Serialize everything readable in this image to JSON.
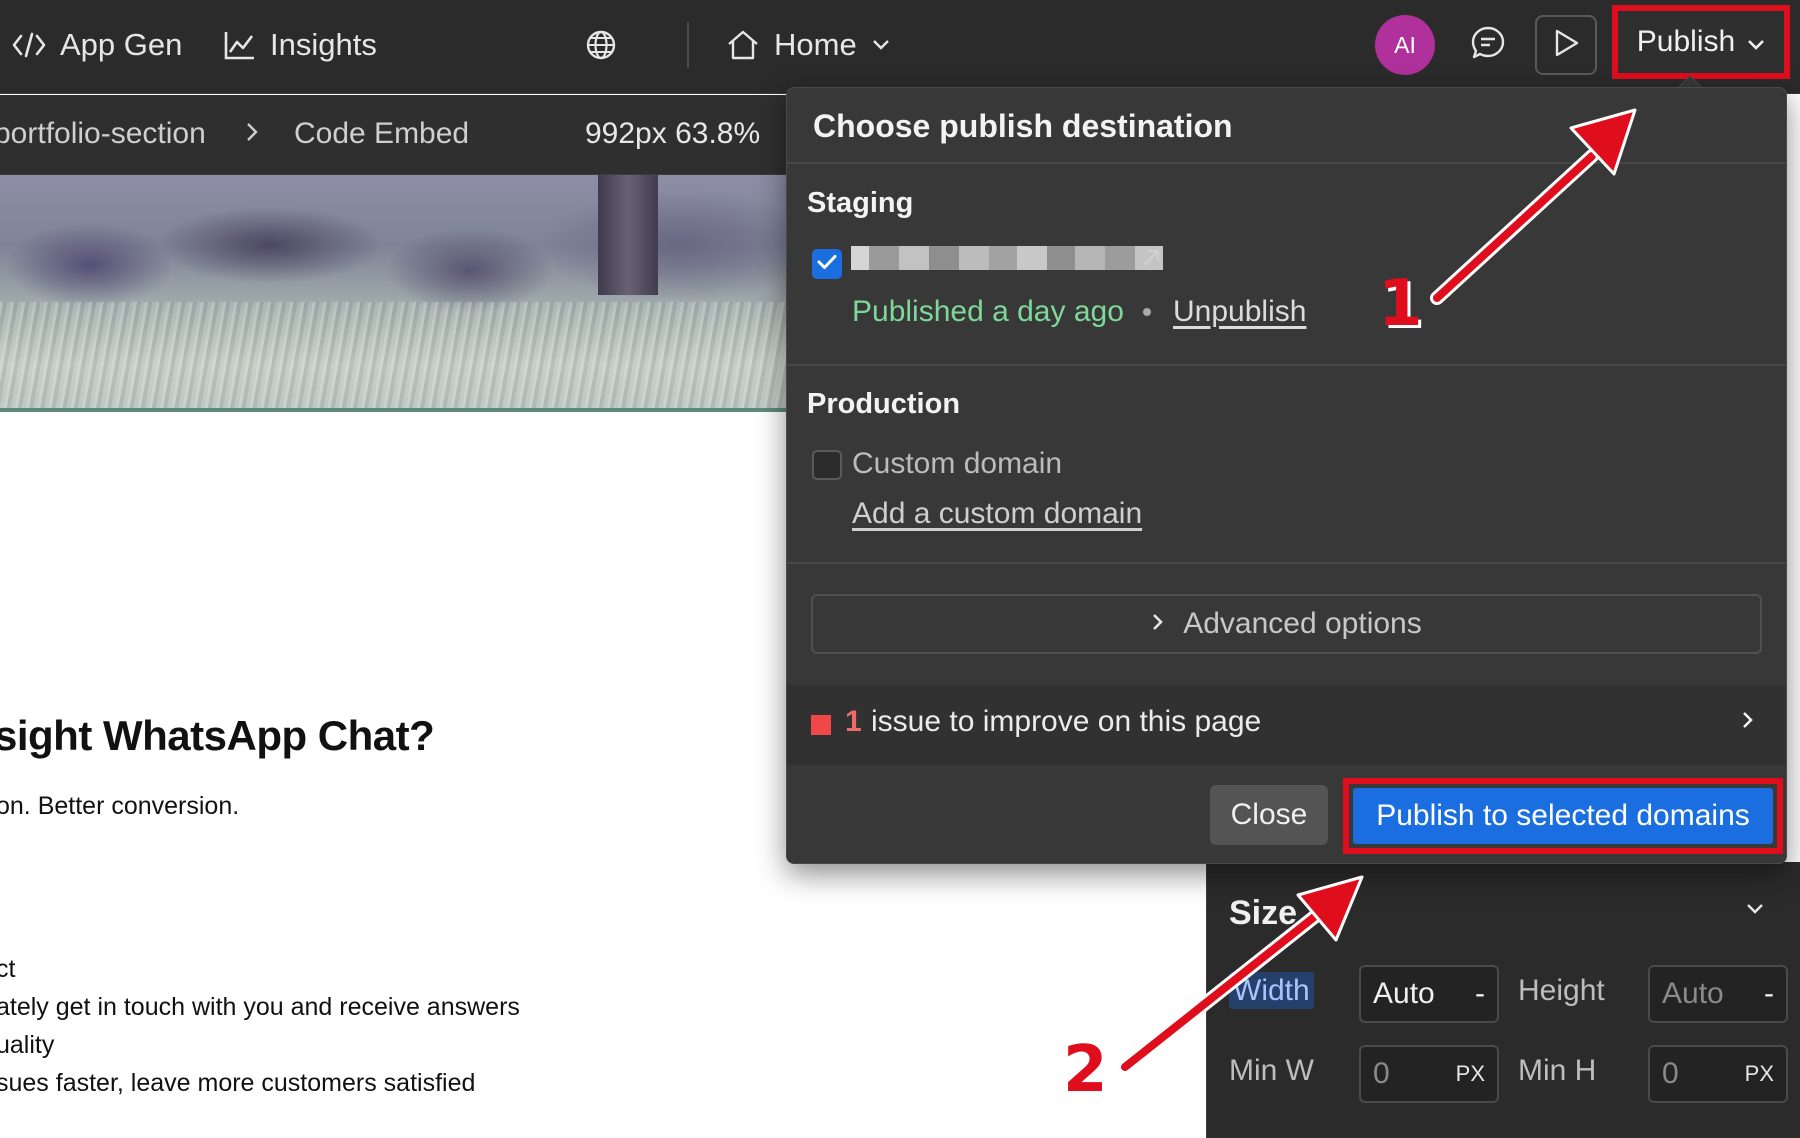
{
  "topbar": {
    "app_gen_label": "App Gen",
    "insights_label": "Insights",
    "home_label": "Home",
    "avatar_initials": "AI",
    "publish_label": "Publish"
  },
  "breadcrumb": {
    "item1": "portfolio-section",
    "item2": "Code Embed",
    "viewport": "992px 63.8%"
  },
  "canvas": {
    "heading": "sight WhatsApp Chat?",
    "subtext": "on. Better conversion.",
    "lines": [
      "ct",
      "ately get in touch with you and receive answers",
      "uality",
      "sues faster, leave more customers satisfied"
    ]
  },
  "publish_dialog": {
    "title": "Choose publish destination",
    "staging": {
      "section_title": "Staging",
      "checked": true,
      "status": "Published a day ago",
      "unpublish_link": "Unpublish"
    },
    "production": {
      "section_title": "Production",
      "custom_domain_label": "Custom domain",
      "checked": false,
      "add_domain_link": "Add a custom domain"
    },
    "advanced_options_label": "Advanced options",
    "issues": {
      "count": "1",
      "text": "issue to improve on this page"
    },
    "close_label": "Close",
    "publish_selected_label": "Publish to selected domains"
  },
  "size_panel": {
    "title": "Size",
    "width_label": "Width",
    "width_value": "Auto",
    "width_suffix": "-",
    "height_label": "Height",
    "height_value": "Auto",
    "height_suffix": "-",
    "min_w_label": "Min W",
    "min_w_value": "0",
    "min_w_unit": "PX",
    "min_h_label": "Min H",
    "min_h_value": "0",
    "min_h_unit": "PX"
  },
  "annotations": {
    "step1": "1",
    "step2": "2",
    "highlight_color": "#e00d1d"
  },
  "colors": {
    "accent_blue": "#1a6ee0",
    "status_green": "#7fd89a",
    "issue_red": "#f04848",
    "avatar_purple": "#b0309c"
  }
}
